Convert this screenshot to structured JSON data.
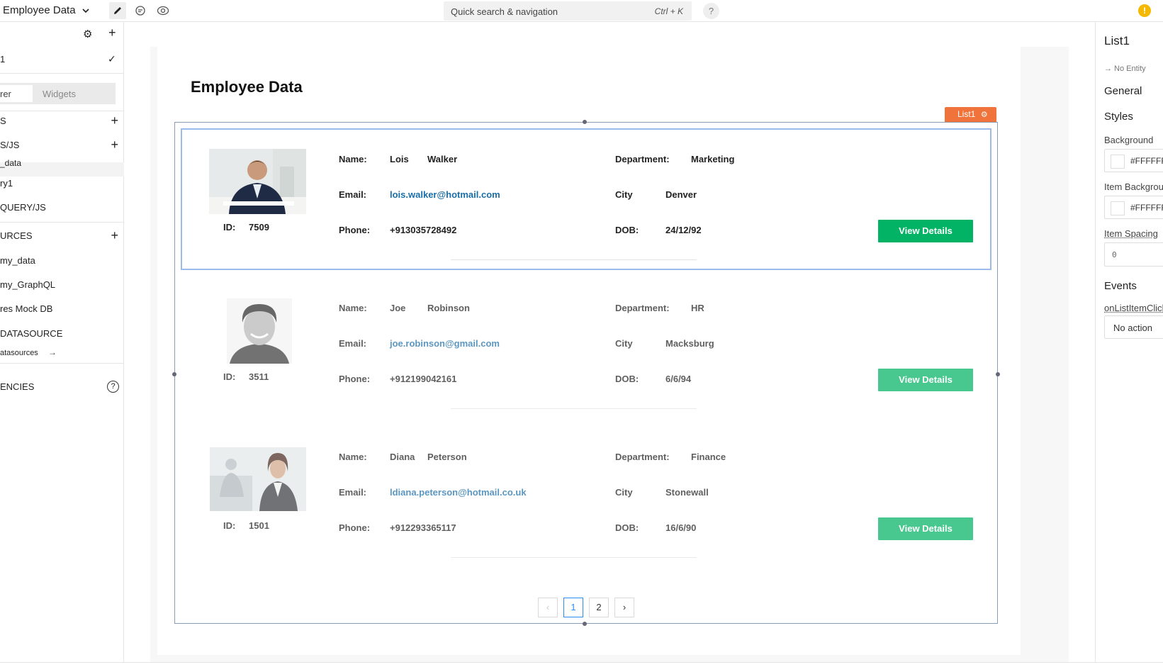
{
  "topbar": {
    "app_title": "Employee Data",
    "search_placeholder": "Quick search & navigation",
    "search_shortcut": "Ctrl + K",
    "help": "?",
    "warning": "!"
  },
  "sidebar": {
    "page_item": "1",
    "tabs": [
      "rer",
      "Widgets"
    ],
    "rows": [
      {
        "text": "S",
        "plus": true
      },
      {
        "text": "S/JS",
        "plus": true
      },
      {
        "text": "_data",
        "plus": false
      },
      {
        "text": "ry1",
        "plus": false
      },
      {
        "text": "QUERY/JS",
        "plus": false
      },
      {
        "text": "URCES",
        "plus": true
      },
      {
        "text": "my_data",
        "plus": false
      },
      {
        "text": "my_GraphQL",
        "plus": false
      },
      {
        "text": "res Mock DB",
        "plus": false
      },
      {
        "text": "DATASOURCE",
        "plus": false
      },
      {
        "text": "atasources",
        "plus": false
      },
      {
        "text": "ENCIES",
        "plus": false
      }
    ],
    "arrow": "→",
    "help": "?"
  },
  "page": {
    "title": "Employee Data",
    "list_tag": "List1"
  },
  "labels": {
    "name": "Name:",
    "email": "Email:",
    "phone": "Phone:",
    "id": "ID:",
    "department": "Department:",
    "city": "City",
    "dob": "DOB:",
    "button": "View Details"
  },
  "employees": [
    {
      "first": "Lois",
      "last": "Walker",
      "email": "lois.walker@hotmail.com",
      "phone": "+913035728492",
      "id": "7509",
      "department": "Marketing",
      "city": "Denver",
      "dob": "24/12/92"
    },
    {
      "first": "Joe",
      "last": "Robinson",
      "email": "joe.robinson@gmail.com",
      "phone": "+912199042161",
      "id": "3511",
      "department": "HR",
      "city": "Macksburg",
      "dob": "6/6/94"
    },
    {
      "first": "Diana",
      "last": "Peterson",
      "email": "ldiana.peterson@hotmail.co.uk",
      "phone": "+912293365117",
      "id": "1501",
      "department": "Finance",
      "city": "Stonewall",
      "dob": "16/6/90"
    }
  ],
  "pagination": {
    "prev": "‹",
    "pages": [
      "1",
      "2"
    ],
    "next": "›",
    "active": "1"
  },
  "rightpanel": {
    "widget_name": "List1",
    "entity": "→ No Entity",
    "general": "General",
    "styles": "Styles",
    "background_label": "Background",
    "background_value": "#FFFFFF",
    "item_bg_label": "Item Background",
    "item_bg_value": "#FFFFFF",
    "item_spacing_label": "Item Spacing",
    "item_spacing_value": "0",
    "events": "Events",
    "event_label": "onListItemClick",
    "event_value": "No action"
  },
  "colors": {
    "accent_green": "#03b365",
    "list_tag": "#f0733b",
    "link": "#1b6ea8"
  }
}
